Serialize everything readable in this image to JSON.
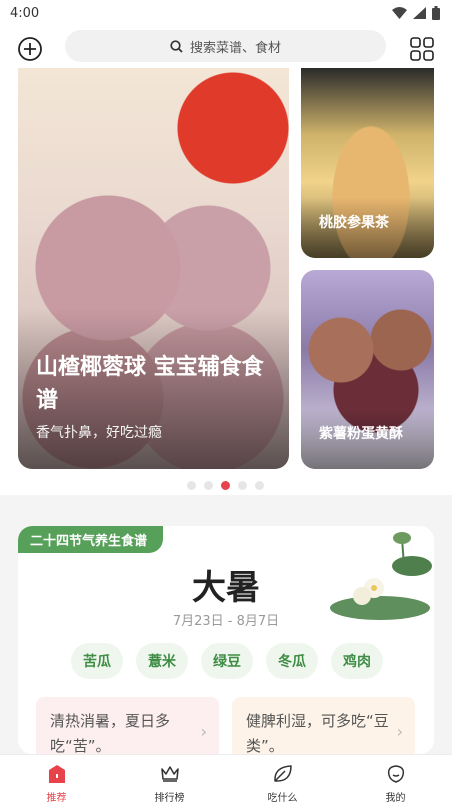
{
  "status_bar": {
    "time": "4:00"
  },
  "search": {
    "placeholder": "搜索菜谱、食材"
  },
  "banner": {
    "main": {
      "title": "山楂椰蓉球 宝宝辅食食谱",
      "subtitle": "香气扑鼻，好吃过瘾"
    },
    "side": [
      {
        "label": "桃胶参果茶"
      },
      {
        "label": "紫薯粉蛋黄酥"
      }
    ],
    "dots_count": 5,
    "active_dot": 3
  },
  "solar_term": {
    "tag": "二十四节气养生食谱",
    "name": "大暑",
    "date_range": "7月23日 - 8月7日",
    "ingredients": [
      "苦瓜",
      "薏米",
      "绿豆",
      "冬瓜",
      "鸡肉"
    ],
    "tips": [
      {
        "text": "清热消暑，夏日多吃“苦”。"
      },
      {
        "text": "健脾利湿，可多吃“豆类”。"
      }
    ]
  },
  "tabs": [
    {
      "label": "推荐",
      "icon": "home-icon",
      "active": true
    },
    {
      "label": "排行榜",
      "icon": "crown-icon",
      "active": false
    },
    {
      "label": "吃什么",
      "icon": "leaf-icon",
      "active": false
    },
    {
      "label": "我的",
      "icon": "profile-icon",
      "active": false
    }
  ],
  "colors": {
    "accent": "#e8424a",
    "green": "#57a05a"
  }
}
